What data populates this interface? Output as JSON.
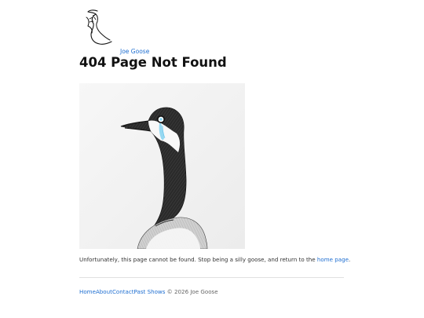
{
  "header": {
    "site_name": "Joe Goose",
    "logo_icon": "goose-sketch-icon"
  },
  "main": {
    "title": "404 Page Not Found",
    "hero_icon": "crying-goose-illustration",
    "message": {
      "before_link": "Unfortunately, this page cannot be found. Stop being a silly goose, and return to the ",
      "link_text": "home page",
      "after_link": "."
    }
  },
  "footer": {
    "links": [
      {
        "label": "Home"
      },
      {
        "label": "About"
      },
      {
        "label": "Contact"
      },
      {
        "label": "Past Shows"
      }
    ],
    "copyright": " © 2026 Joe Goose"
  },
  "colors": {
    "link": "#1f6fd1",
    "text": "#333333",
    "title": "#111111",
    "tear": "#8bd4ef"
  }
}
